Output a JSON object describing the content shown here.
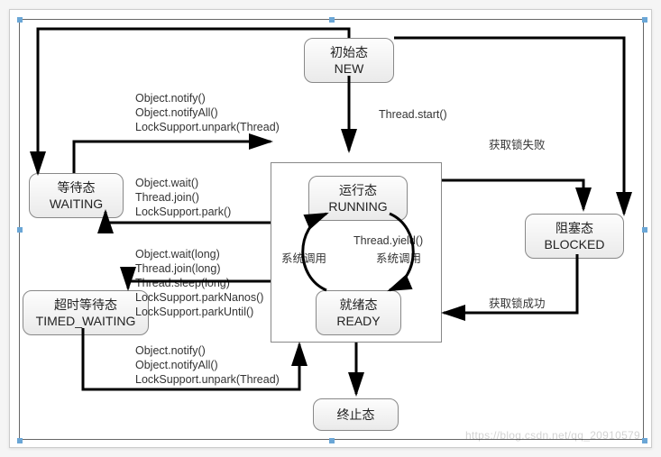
{
  "states": {
    "new": {
      "cn": "初始态",
      "en": "NEW"
    },
    "running": {
      "cn": "运行态",
      "en": "RUNNING"
    },
    "ready": {
      "cn": "就绪态",
      "en": "READY"
    },
    "waiting": {
      "cn": "等待态",
      "en": "WAITING"
    },
    "timed_waiting": {
      "cn": "超时等待态",
      "en": "TIMED_WAITING"
    },
    "blocked": {
      "cn": "阻塞态",
      "en": "BLOCKED"
    },
    "terminated": {
      "cn": "终止态",
      "en": ""
    }
  },
  "labels": {
    "thread_start": "Thread.start()",
    "notify1": "Object.notify()",
    "notify2": "Object.notifyAll()",
    "notify3": "LockSupport.unpark(Thread)",
    "wait1": "Object.wait()",
    "wait2": "Thread.join()",
    "wait3": "LockSupport.park()",
    "twait1": "Object.wait(long)",
    "twait2": "Thread.join(long)",
    "twait3": "Thread.sleep(long)",
    "twait4": "LockSupport.parkNanos()",
    "twait5": "LockSupport.parkUntil()",
    "tnotify1": "Object.notify()",
    "tnotify2": "Object.notifyAll()",
    "tnotify3": "LockSupport.unpark(Thread)",
    "yield1": "Thread.yield()",
    "yield2": "系统调用",
    "syscall": "系统调用",
    "lock_fail": "获取锁失败",
    "lock_ok": "获取锁成功"
  },
  "watermark": "https://blog.csdn.net/qq_20910579"
}
